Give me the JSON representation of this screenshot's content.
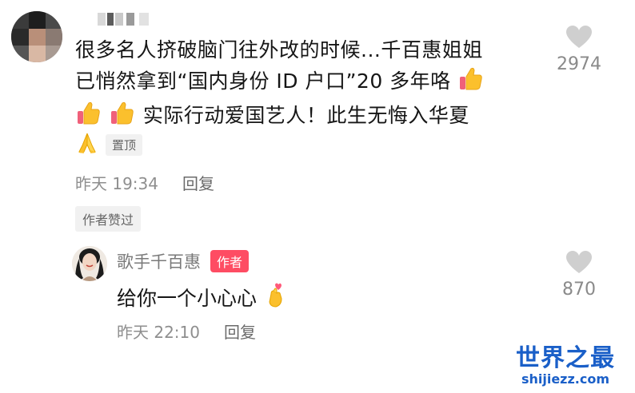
{
  "comment": {
    "lines": [
      "很多名人挤破脑门往外改的时候...千百惠姐姐",
      "已悄然拿到“国内身份 ID 户口”20 多年咯",
      "实际行动爱国艺人！此生无悔入华夏"
    ],
    "pinned_label": "置顶",
    "time": "昨天 19:34",
    "reply_label": "回复",
    "likes": "2974",
    "author_liked_badge": "作者赞过"
  },
  "reply": {
    "author_name": "歌手千百惠",
    "author_tag": "作者",
    "text": "给你一个小心心",
    "time": "昨天 22:10",
    "reply_label": "回复",
    "likes": "870"
  },
  "watermark": {
    "title": "世界之最",
    "url": "shijiezz.com"
  },
  "icons": {
    "like": "heart-icon",
    "thumbs_up": "thumbs-up-emoji",
    "pray": "folded-hands-emoji",
    "finger_heart": "finger-heart-emoji"
  },
  "colors": {
    "author_tag": "#fe4c63",
    "like_icon": "#cfcfcf",
    "meta_text": "#8e8e8e",
    "watermark": "#1a5fc8"
  }
}
